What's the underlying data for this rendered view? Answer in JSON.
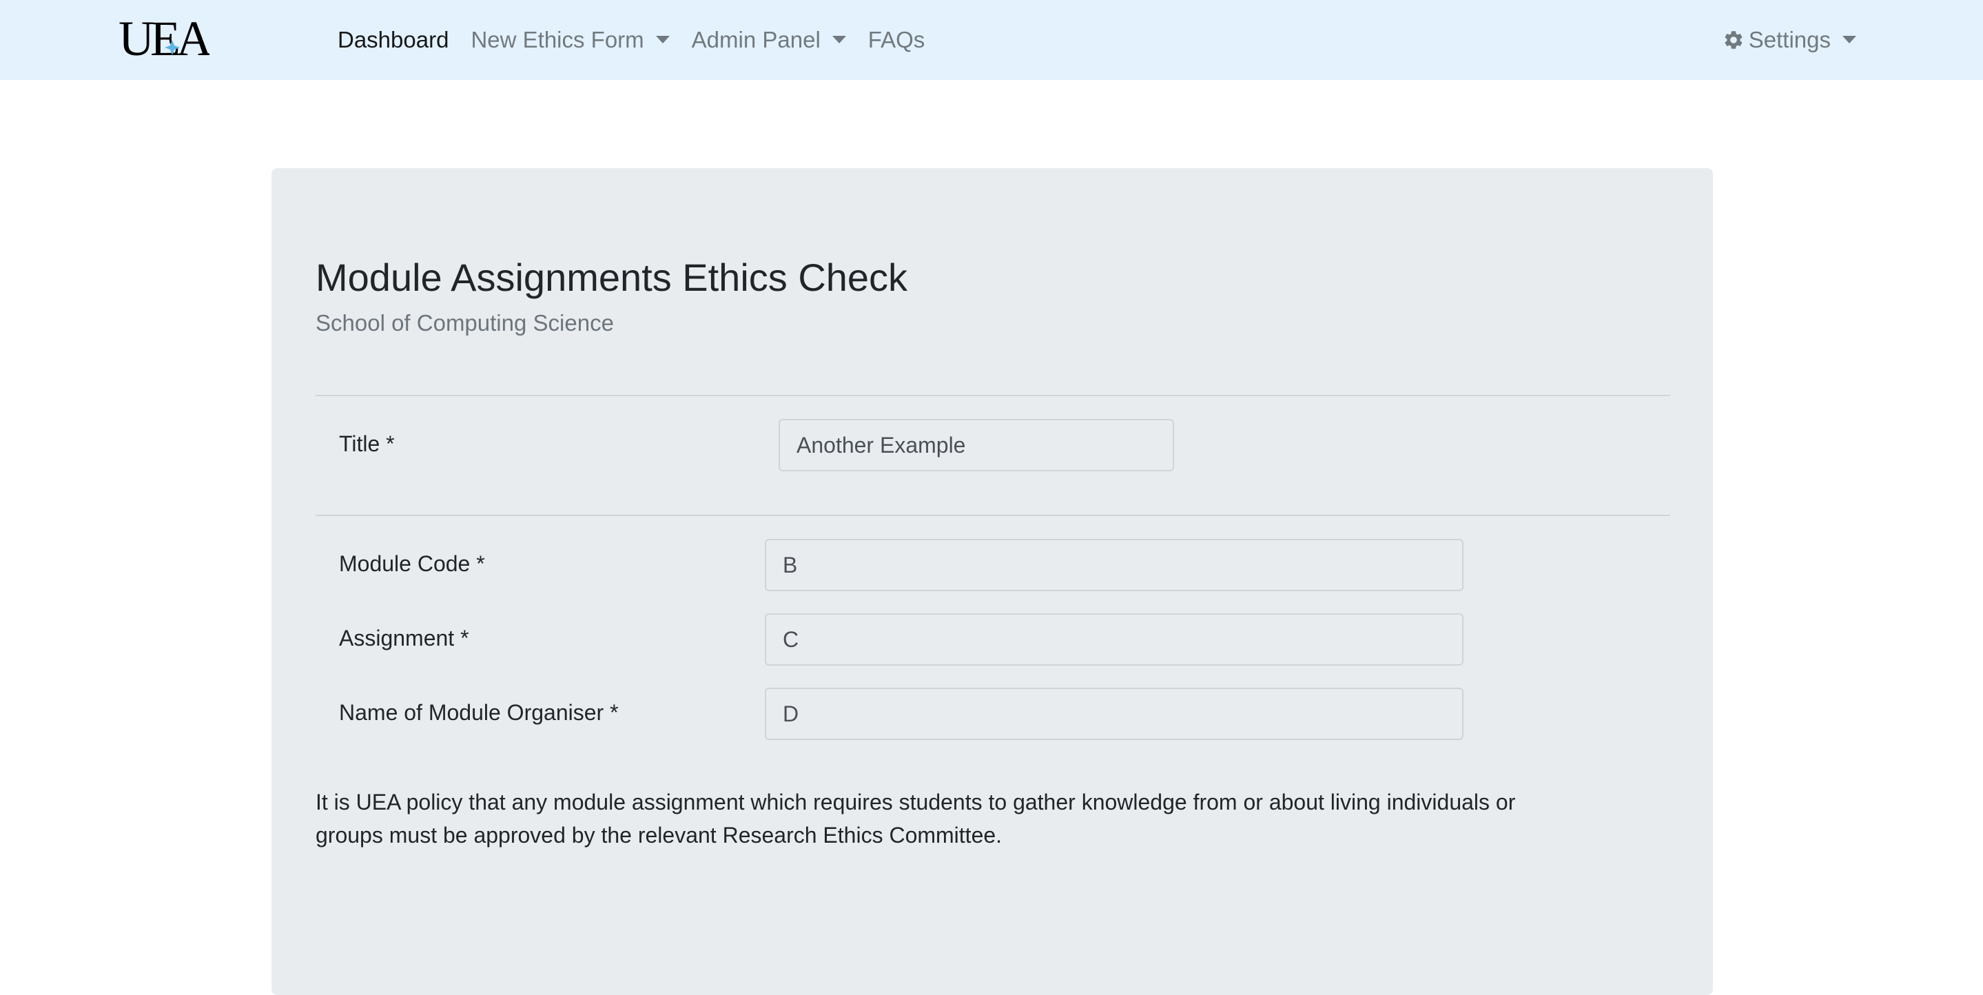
{
  "nav": {
    "brand_label": "UEA",
    "links": [
      {
        "label": "Dashboard",
        "active": true,
        "dropdown": false
      },
      {
        "label": "New Ethics Form",
        "active": false,
        "dropdown": true
      },
      {
        "label": "Admin Panel",
        "active": false,
        "dropdown": true
      },
      {
        "label": "FAQs",
        "active": false,
        "dropdown": false
      }
    ],
    "settings_label": "Settings",
    "settings_icon": "gear-icon",
    "background_color": "#e3f2fd"
  },
  "form": {
    "title": "Module Assignments Ethics Check",
    "subtitle": "School of Computing Science",
    "fields": {
      "title": {
        "label": "Title *",
        "value": "Another Example"
      },
      "module_code": {
        "label": "Module Code *",
        "value": "B"
      },
      "assignment": {
        "label": "Assignment *",
        "value": "C"
      },
      "organiser": {
        "label": "Name of Module Organiser *",
        "value": "D"
      }
    },
    "policy_text": "It is UEA policy that any module assignment which requires students to gather knowledge from or about living individuals or groups must be approved by the relevant Research Ethics Committee.",
    "card_color": "#e9ecef"
  }
}
